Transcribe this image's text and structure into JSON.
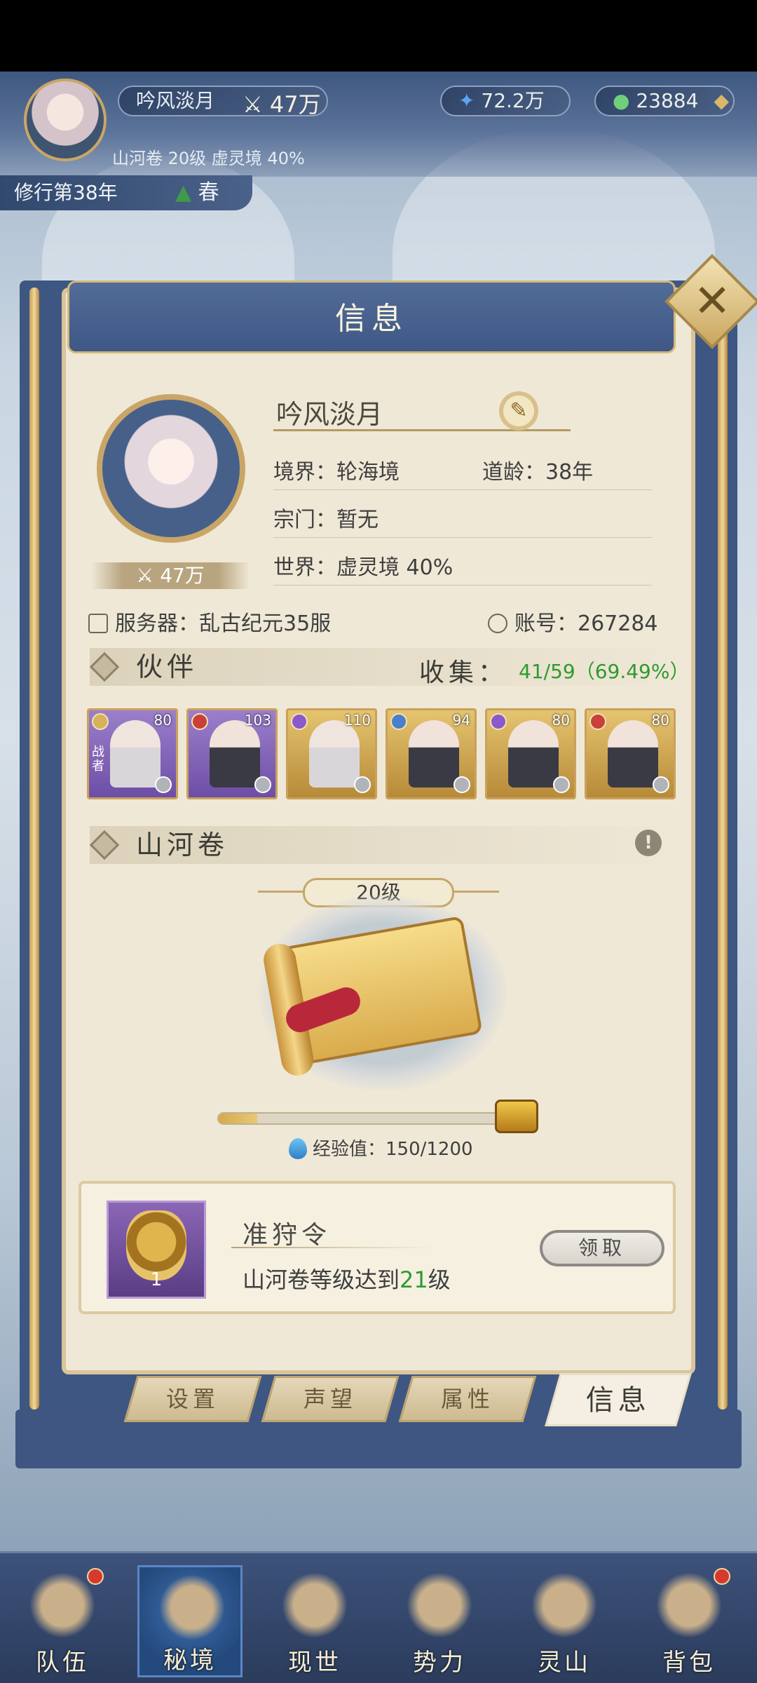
{
  "header": {
    "player_name": "吟风淡月",
    "power": "47万",
    "spirit_stones": "72.2万",
    "coins": "23884",
    "realm_line": "山河卷 20级 虚灵境 40%",
    "cultivation_year": "修行第38年",
    "season": "春"
  },
  "panel": {
    "title": "信息",
    "close_icon": "✕",
    "profile": {
      "name": "吟风淡月",
      "power_badge": "47万",
      "realm": "境界：轮海境",
      "dao_age": "道龄：38年",
      "sect": "宗门：暂无",
      "world": "世界：虚灵境  40%",
      "server": "服务器：乱古纪元35服",
      "account": "账号：267284"
    },
    "companions": {
      "section_title": "伙伴",
      "collect_label": "收集：",
      "collect_value": "41/59（69.49%）",
      "cards": [
        {
          "level": "80",
          "tag": "战者",
          "rarity": "purple",
          "element": "gold"
        },
        {
          "level": "103",
          "tag": "",
          "rarity": "purple",
          "element": "red"
        },
        {
          "level": "110",
          "tag": "",
          "rarity": "gold",
          "element": "purple"
        },
        {
          "level": "94",
          "tag": "",
          "rarity": "gold",
          "element": "blue"
        },
        {
          "level": "80",
          "tag": "",
          "rarity": "gold",
          "element": "purple"
        },
        {
          "level": "80",
          "tag": "",
          "rarity": "gold",
          "element": "red"
        }
      ]
    },
    "scroll": {
      "section_title": "山河卷",
      "info_icon": "!",
      "level": "20级",
      "exp_label": "经验值：150/1200",
      "exp_progress": 0.125
    },
    "reward": {
      "name": "准狩令",
      "count": "1",
      "desc_prefix": "山河卷等级达到",
      "desc_level": "21",
      "desc_suffix": "级",
      "claim_label": "领取"
    },
    "tabs": [
      {
        "label": "设置",
        "active": false
      },
      {
        "label": "声望",
        "active": false
      },
      {
        "label": "属性",
        "active": false
      },
      {
        "label": "信息",
        "active": true
      }
    ]
  },
  "bottom_nav": [
    {
      "label": "队伍",
      "badge": true,
      "active": false,
      "icon": "team-icon"
    },
    {
      "label": "秘境",
      "badge": false,
      "active": true,
      "icon": "secret-realm-icon"
    },
    {
      "label": "现世",
      "badge": false,
      "active": false,
      "icon": "world-scroll-icon"
    },
    {
      "label": "势力",
      "badge": false,
      "active": false,
      "icon": "faction-icon"
    },
    {
      "label": "灵山",
      "badge": false,
      "active": false,
      "icon": "spirit-mountain-icon"
    },
    {
      "label": "背包",
      "badge": true,
      "active": false,
      "icon": "bag-icon"
    }
  ],
  "colors": {
    "accent_green": "#2e9a2e",
    "panel_blue": "#3f5886",
    "gold": "#c9a667"
  }
}
